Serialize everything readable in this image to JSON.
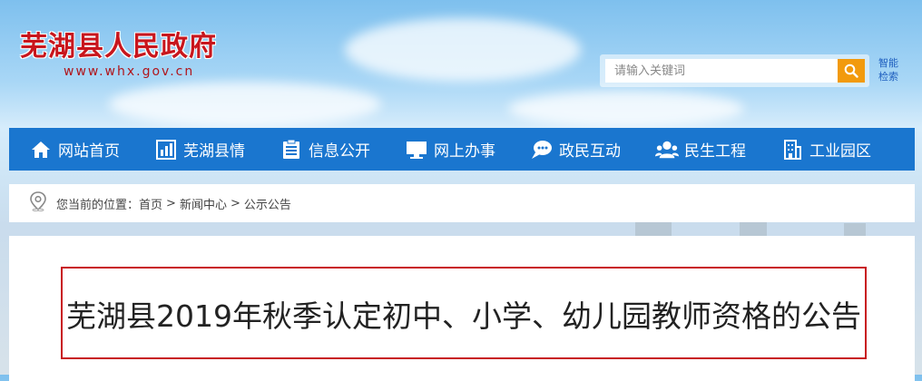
{
  "site": {
    "title": "芜湖县人民政府",
    "url": "www.whx.gov.cn"
  },
  "search": {
    "placeholder": "请输入关键词",
    "smart_search_line1": "智能",
    "smart_search_line2": "检索"
  },
  "nav": {
    "items": [
      {
        "label": "网站首页",
        "icon": "home-icon"
      },
      {
        "label": "芜湖县情",
        "icon": "chart-icon"
      },
      {
        "label": "信息公开",
        "icon": "list-icon"
      },
      {
        "label": "网上办事",
        "icon": "monitor-icon"
      },
      {
        "label": "政民互动",
        "icon": "chat-icon"
      },
      {
        "label": "民生工程",
        "icon": "people-icon"
      },
      {
        "label": "工业园区",
        "icon": "building-icon"
      }
    ]
  },
  "breadcrumb": {
    "prefix": "您当前的位置：",
    "items": [
      "首页",
      "新闻中心",
      "公示公告"
    ],
    "separator": ">"
  },
  "article": {
    "title": "芜湖县2019年秋季认定初中、小学、幼儿园教师资格的公告"
  },
  "colors": {
    "nav_bg": "#1a76cf",
    "accent_red": "#c8161d",
    "search_button": "#f29a0d"
  }
}
